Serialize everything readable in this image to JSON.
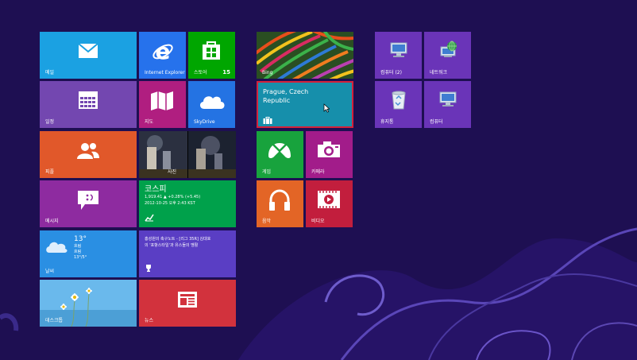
{
  "tiles": {
    "mail": {
      "label": "메일",
      "color": "#1ba1e2"
    },
    "ie": {
      "label": "Internet Explorer",
      "color": "#2672ec"
    },
    "store": {
      "label": "스토어",
      "badge": "15",
      "color": "#00a600"
    },
    "calendar": {
      "label": "일정",
      "color": "#7347b0"
    },
    "maps": {
      "label": "지도",
      "color": "#b01e80"
    },
    "skydrive": {
      "label": "SkyDrive",
      "color": "#2473e3"
    },
    "people": {
      "label": "피플",
      "color": "#e1582a"
    },
    "photos": {
      "label": "사진"
    },
    "finance": {
      "label": "",
      "title": "코스피",
      "line1": "1,919.41  ▲ +0.28% (+5.45)",
      "line2": "2012-10-25 오후 2:43 KST",
      "color": "#00a14b"
    },
    "messaging": {
      "label": "메시지",
      "color": "#8e2ba0"
    },
    "weather": {
      "label": "날씨",
      "temp": "13°",
      "cond": "흐림",
      "cond2": "흐림",
      "range": "13°/5°",
      "color": "#2a8fe3"
    },
    "sports": {
      "headline1": "홍성원의 축구노트 - [리그 35R] 김대호",
      "headline2": "의 '포항스타일'과 유스들의 맹활",
      "color": "#5a3ec4"
    },
    "desktop": {
      "label": "데스크톱"
    },
    "news": {
      "label": "뉴스",
      "color": "#d2323d"
    },
    "bing": {
      "label": "Bing"
    },
    "travel": {
      "label": "",
      "title": "Prague, Czech Republic",
      "color": "#168fab",
      "border": "#d4213b"
    },
    "games": {
      "label": "게임",
      "color": "#18a33d"
    },
    "camera": {
      "label": "카메라",
      "color": "#a21c8a"
    },
    "music": {
      "label": "음악",
      "color": "#e36526"
    },
    "video": {
      "label": "비디오",
      "color": "#c21e3d"
    },
    "computer1": {
      "label": "컴퓨터 (2)",
      "color": "#6a34b8"
    },
    "network": {
      "label": "네트워크",
      "color": "#6a34b8"
    },
    "recycle": {
      "label": "휴지통",
      "color": "#6a34b8"
    },
    "computer2": {
      "label": "컴퓨터",
      "color": "#6a34b8"
    }
  }
}
